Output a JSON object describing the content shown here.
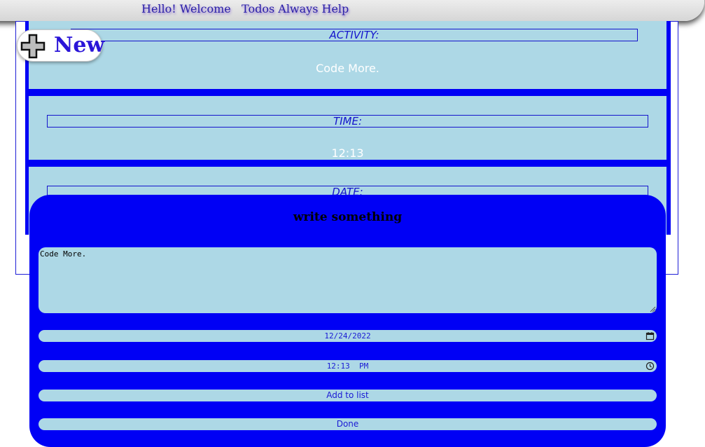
{
  "header": {
    "title": "Hello! Welcome   Todos Always Help"
  },
  "new_button": {
    "label": "New"
  },
  "cards": [
    {
      "label": "ACTIVITY:",
      "value": "Code More."
    },
    {
      "label": "TIME:",
      "value": "12:13"
    },
    {
      "label": "DATE:",
      "value": ""
    }
  ],
  "form": {
    "heading": "write something",
    "textarea_value": "Code More.",
    "date_value": "12/24/2022",
    "time_value": "12:13  PM",
    "add_label": "Add to list",
    "done_label": "Done"
  },
  "colors": {
    "accent": "#0000f5",
    "card": "#add8e6",
    "text_blue": "#1a1ad4"
  },
  "icons": {
    "new": "plus-icon",
    "date": "calendar-icon",
    "time": "clock-icon",
    "resize": "resize-grip-icon"
  }
}
